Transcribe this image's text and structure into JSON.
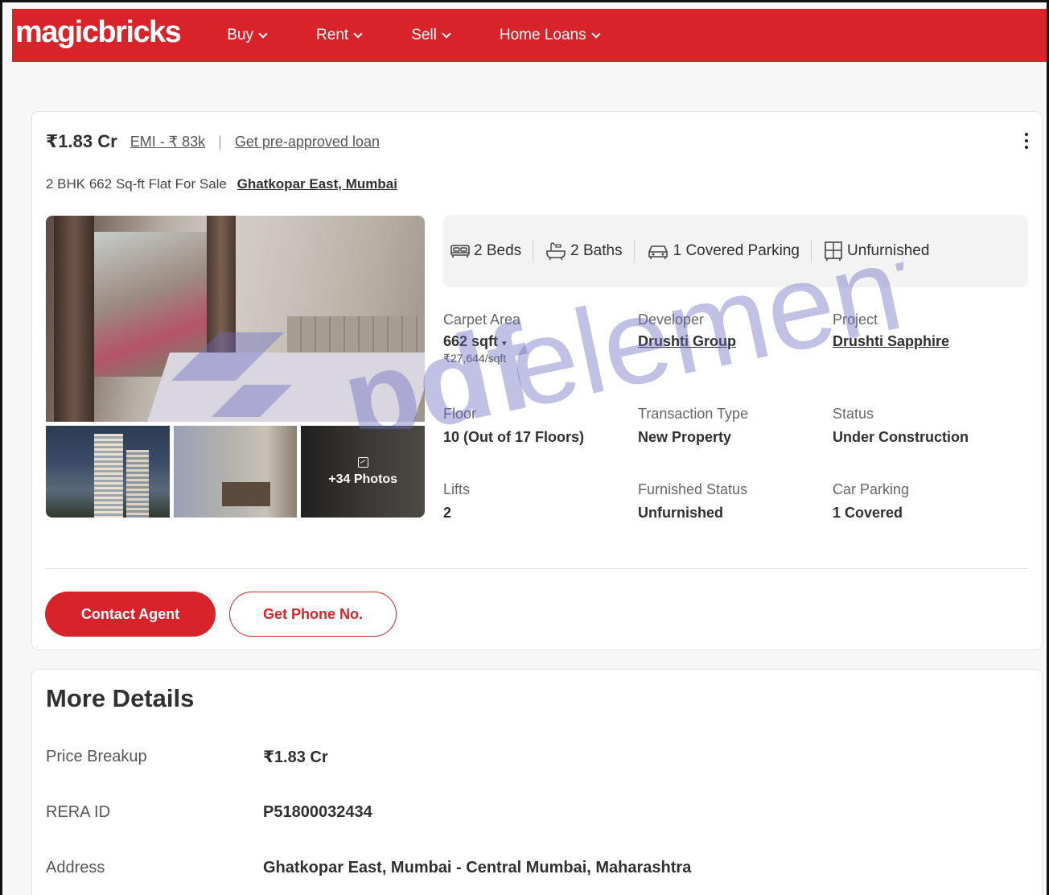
{
  "header": {
    "logo": "magicbricks",
    "nav": [
      {
        "label": "Buy"
      },
      {
        "label": "Rent"
      },
      {
        "label": "Sell"
      },
      {
        "label": "Home Loans"
      }
    ]
  },
  "listing": {
    "price": "₹1.83 Cr",
    "emi": "EMI - ₹ 83k",
    "separator": "|",
    "loan_link": "Get pre-approved loan",
    "title": "2 BHK 662 Sq-ft Flat For Sale",
    "location": "Ghatkopar East, Mumbai",
    "photos_label": "+34 Photos",
    "amenities": [
      {
        "icon": "bed-icon",
        "label": "2 Beds"
      },
      {
        "icon": "bath-icon",
        "label": "2 Baths"
      },
      {
        "icon": "car-icon",
        "label": "1 Covered Parking"
      },
      {
        "icon": "furniture-icon",
        "label": "Unfurnished"
      }
    ],
    "specs": {
      "carpet_area": {
        "label": "Carpet Area",
        "value": "662 sqft",
        "sub": "₹27,644/sqft"
      },
      "developer": {
        "label": "Developer",
        "value": "Drushti Group"
      },
      "project": {
        "label": "Project",
        "value": "Drushti Sapphire"
      },
      "floor": {
        "label": "Floor",
        "value": "10 (Out of 17 Floors)"
      },
      "transaction": {
        "label": "Transaction Type",
        "value": "New Property"
      },
      "status": {
        "label": "Status",
        "value": "Under Construction"
      },
      "lifts": {
        "label": "Lifts",
        "value": "2"
      },
      "furnished": {
        "label": "Furnished Status",
        "value": "Unfurnished"
      },
      "car_parking": {
        "label": "Car Parking",
        "value": "1 Covered"
      }
    },
    "buttons": {
      "contact": "Contact Agent",
      "phone": "Get Phone No."
    }
  },
  "more_details": {
    "title": "More Details",
    "rows": [
      {
        "key": "Price Breakup",
        "value": "₹1.83 Cr"
      },
      {
        "key": "RERA ID",
        "value": "P51800032434"
      },
      {
        "key": "Address",
        "value": "Ghatkopar East, Mumbai - Central Mumbai, Maharashtra"
      }
    ]
  },
  "watermark": {
    "text_bold": "pdf",
    "text_light": "element"
  },
  "colors": {
    "brand_red": "#d8232a",
    "watermark": "#6c6cc0"
  }
}
